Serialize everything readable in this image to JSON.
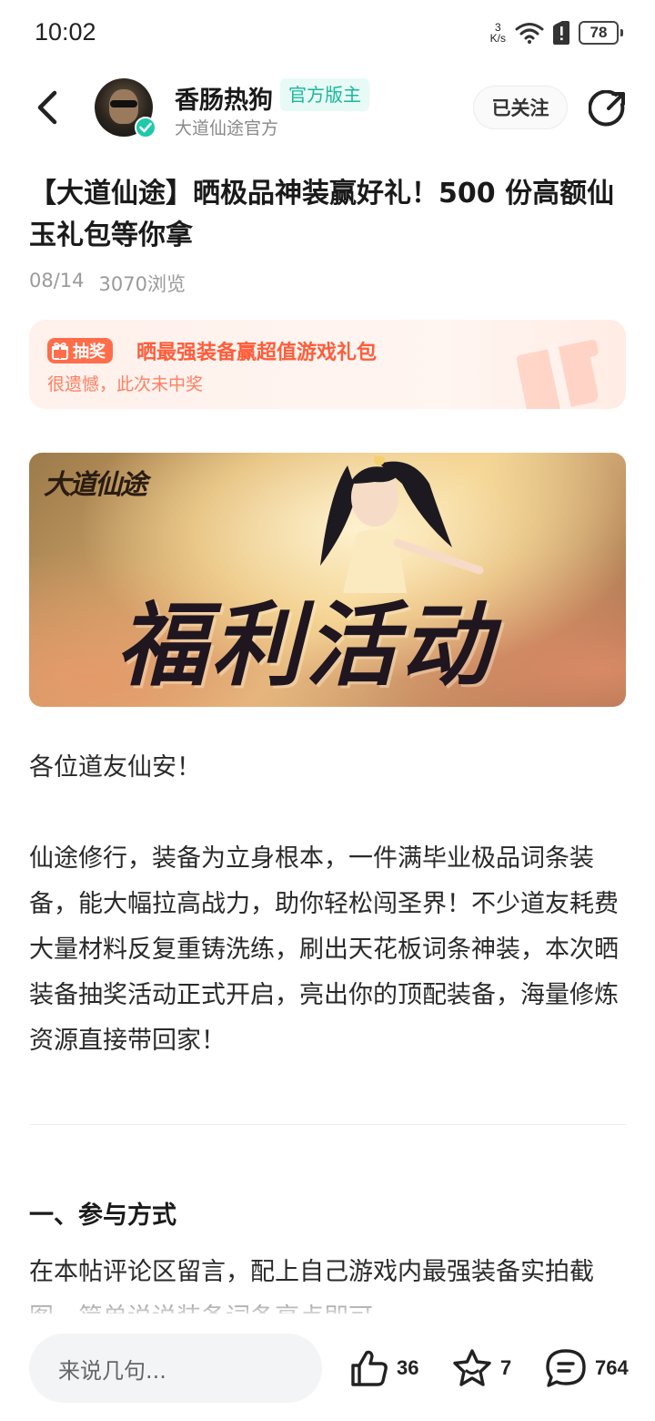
{
  "status_bar": {
    "time": "10:02",
    "net_speed_value": "3",
    "net_speed_unit": "K/s",
    "battery": "78"
  },
  "header": {
    "author_name": "香肠热狗",
    "author_badge": "官方版主",
    "author_subtitle": "大道仙途官方",
    "follow_label": "已关注"
  },
  "post": {
    "title": "【大道仙途】晒极品神装赢好礼！500 份高额仙玉礼包等你拿",
    "date": "08/14",
    "views": "3070浏览"
  },
  "lottery": {
    "tag": "抽奖",
    "title": "晒最强装备赢超值游戏礼包",
    "status": "很遗憾，此次未中奖"
  },
  "banner": {
    "logo_text": "大道仙途",
    "title": "福利活动"
  },
  "body": {
    "greeting": "各位道友仙安！",
    "paragraph": "仙途修行，装备为立身根本，一件满毕业极品词条装备，能大幅拉高战力，助你轻松闯圣界！不少道友耗费大量材料反复重铸洗练，刷出天花板词条神装，本次晒装备抽奖活动正式开启，亮出你的顶配装备，海量修炼资源直接带回家！",
    "section_title": "一、参与方式",
    "section_text": "在本帖评论区留言，配上自己游戏内最强装备实拍截图，简单说说装备词条亮点即可。"
  },
  "bottom_bar": {
    "comment_placeholder": "来说几句...",
    "like_count": "36",
    "favorite_count": "7",
    "comment_count": "764"
  },
  "colors": {
    "accent_green": "#20c9a9",
    "lottery_orange": "#ff5c3a"
  }
}
